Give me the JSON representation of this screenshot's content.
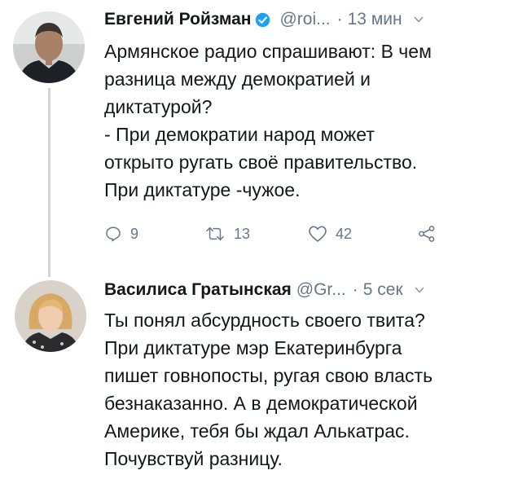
{
  "tweets": [
    {
      "author": "Евгений Ройзман",
      "verified": true,
      "handle": "@roi...",
      "dot": "·",
      "time": "13 мин",
      "lines": [
        "Армянское радио спрашивают: В чем",
        "разница между демократией и",
        "диктатурой?",
        " - При демократии народ может",
        "открыто ругать своё правительство.",
        "При диктатуре -чужое."
      ],
      "actions": {
        "replies": "9",
        "retweets": "13",
        "likes": "42"
      }
    },
    {
      "author": "Василиса Гратынская",
      "verified": false,
      "handle": "@Gr...",
      "dot": "·",
      "time": "5 сек",
      "lines": [
        "Ты понял абсурдность своего твита?",
        "При диктатуре мэр Екатеринбурга",
        "пишет говнопосты, ругая свою власть",
        "безнаказанно. А в демократической",
        "Америке, тебя бы ждал Алькатрас.",
        "Почувствуй разницу."
      ]
    }
  ],
  "colors": {
    "text": "#14171a",
    "secondary": "#657786",
    "verified": "#1da1f2",
    "thread_line": "#ccd6dd"
  }
}
